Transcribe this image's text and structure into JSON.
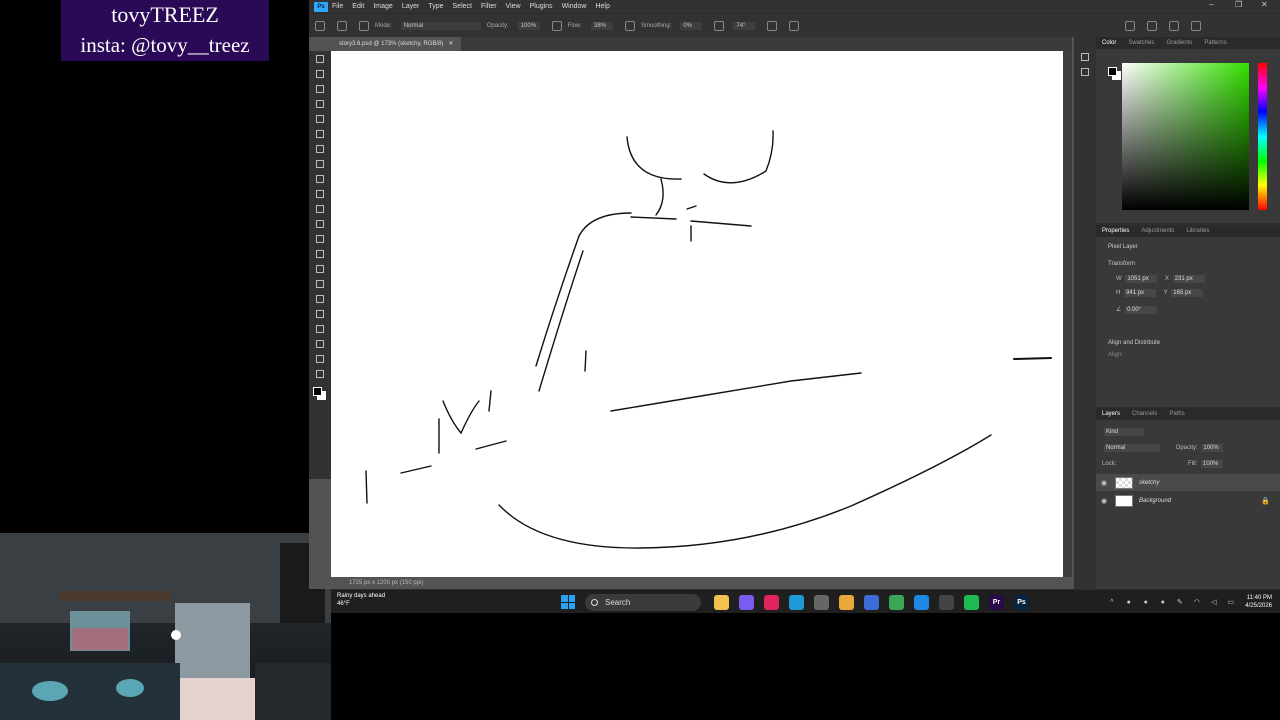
{
  "overlay": {
    "line1": "tovyTREEZ",
    "line2": "insta: @tovy__treez"
  },
  "photoshop": {
    "menu": [
      "File",
      "Edit",
      "Image",
      "Layer",
      "Type",
      "Select",
      "Filter",
      "View",
      "Plugins",
      "Window",
      "Help"
    ],
    "options": {
      "mode_label": "Mode:",
      "mode_value": "Normal",
      "opacity_label": "Opacity:",
      "opacity_value": "100%",
      "flow_label": "Flow:",
      "flow_value": "38%",
      "smoothing_label": "Smoothing:",
      "smoothing_value": "0%",
      "angle_value": "74°"
    },
    "document_tab": "story3.6.psd @ 173% (sketchy, RGB/8)",
    "status": "1725 px x 1200 px (150 ppi)",
    "tools": [
      "move",
      "marquee",
      "lasso",
      "object-select",
      "crop",
      "frame",
      "eyedropper",
      "healing",
      "brush",
      "stamp",
      "history-brush",
      "eraser",
      "paint-bucket",
      "blur",
      "dodge",
      "pen",
      "type",
      "path-select",
      "line",
      "hand",
      "zoom",
      "more"
    ]
  },
  "color_panel": {
    "tabs": [
      "Color",
      "Swatches",
      "Gradients",
      "Patterns"
    ]
  },
  "properties_panel": {
    "tabs": [
      "Properties",
      "Adjustments",
      "Libraries"
    ],
    "layer_type": "Pixel Layer",
    "transform_label": "Transform",
    "w_label": "W",
    "w_value": "1051 px",
    "h_label": "H",
    "h_value": "941 px",
    "x_label": "X",
    "x_value": "231 px",
    "y_label": "Y",
    "y_value": "165 px",
    "angle_value": "0.00°",
    "align_label": "Align and Distribute",
    "align_sub": "Align:"
  },
  "layers_panel": {
    "tabs": [
      "Layers",
      "Channels",
      "Paths"
    ],
    "filter_label": "Kind",
    "blend_mode": "Normal",
    "opacity_label": "Opacity:",
    "opacity_value": "100%",
    "lock_label": "Lock:",
    "fill_label": "Fill:",
    "fill_value": "100%",
    "layers": [
      {
        "name": "sketchy",
        "selected": true
      },
      {
        "name": "Background",
        "selected": false
      }
    ]
  },
  "taskbar": {
    "weather_title": "Rainy days ahead",
    "weather_temp": "46°F",
    "search_label": "Search",
    "time": "11:40 PM",
    "date": "4/25/2026",
    "apps": [
      {
        "name": "file-explorer",
        "label": "",
        "color": "#f2c14e"
      },
      {
        "name": "copilot",
        "label": "",
        "color": "#7b5cf0"
      },
      {
        "name": "app-red",
        "label": "",
        "color": "#e0245e"
      },
      {
        "name": "edge",
        "label": "",
        "color": "#1f9ad6"
      },
      {
        "name": "app-gray",
        "label": "",
        "color": "#666"
      },
      {
        "name": "folder",
        "label": "",
        "color": "#e8a93a"
      },
      {
        "name": "pen-app",
        "label": "",
        "color": "#3d6cd9"
      },
      {
        "name": "chrome",
        "label": "",
        "color": "#3aa757"
      },
      {
        "name": "blue-app",
        "label": "",
        "color": "#1e88e5"
      },
      {
        "name": "obs",
        "label": "",
        "color": "#444"
      },
      {
        "name": "spotify",
        "label": "",
        "color": "#1db954"
      },
      {
        "name": "premiere",
        "label": "Pr",
        "color": "#2a0a4a"
      },
      {
        "name": "photoshop",
        "label": "Ps",
        "color": "#0a2540"
      }
    ]
  }
}
